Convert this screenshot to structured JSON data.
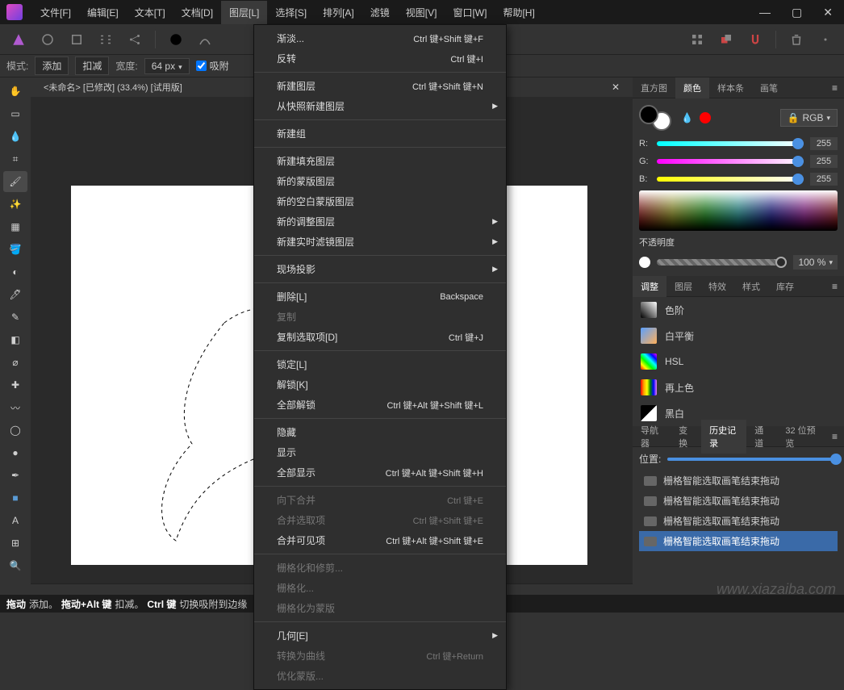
{
  "menubar": [
    "文件[F]",
    "编辑[E]",
    "文本[T]",
    "文档[D]",
    "图层[L]",
    "选择[S]",
    "排列[A]",
    "滤镜",
    "视图[V]",
    "窗口[W]",
    "帮助[H]"
  ],
  "menubar_active_index": 4,
  "options": {
    "mode_label": "模式:",
    "mode_add": "添加",
    "mode_sub": "扣减",
    "width_label": "宽度:",
    "width_value": "64 px",
    "snap_label": "吸附"
  },
  "document": {
    "tab_title": "<未命名> [已修改] (33.4%) [试用版]"
  },
  "dropdown": {
    "items": [
      {
        "label": "渐淡...",
        "shortcut": "Ctrl 键+Shift 键+F"
      },
      {
        "label": "反转",
        "shortcut": "Ctrl 键+I"
      },
      {
        "sep": true
      },
      {
        "label": "新建图层",
        "shortcut": "Ctrl 键+Shift 键+N"
      },
      {
        "label": "从快照新建图层",
        "submenu": true
      },
      {
        "sep": true
      },
      {
        "label": "新建组"
      },
      {
        "sep": true
      },
      {
        "label": "新建填充图层"
      },
      {
        "label": "新的蒙版图层"
      },
      {
        "label": "新的空白蒙版图层"
      },
      {
        "label": "新的调整图层",
        "submenu": true
      },
      {
        "label": "新建实时滤镜图层",
        "submenu": true
      },
      {
        "sep": true
      },
      {
        "label": "现场投影",
        "submenu": true
      },
      {
        "sep": true
      },
      {
        "label": "删除[L]",
        "shortcut": "Backspace"
      },
      {
        "label": "复制",
        "disabled": true
      },
      {
        "label": "复制选取项[D]",
        "shortcut": "Ctrl 键+J"
      },
      {
        "sep": true
      },
      {
        "label": "锁定[L]"
      },
      {
        "label": "解锁[K]"
      },
      {
        "label": "全部解锁",
        "shortcut": "Ctrl 键+Alt 键+Shift 键+L"
      },
      {
        "sep": true
      },
      {
        "label": "隐藏"
      },
      {
        "label": "显示"
      },
      {
        "label": "全部显示",
        "shortcut": "Ctrl 键+Alt 键+Shift 键+H"
      },
      {
        "sep": true
      },
      {
        "label": "向下合并",
        "shortcut": "Ctrl 键+E",
        "disabled": true
      },
      {
        "label": "合并选取项",
        "shortcut": "Ctrl 键+Shift 键+E",
        "disabled": true
      },
      {
        "label": "合并可见项",
        "shortcut": "Ctrl 键+Alt 键+Shift 键+E"
      },
      {
        "sep": true
      },
      {
        "label": "栅格化和修剪...",
        "disabled": true
      },
      {
        "label": "栅格化...",
        "disabled": true
      },
      {
        "label": "栅格化为蒙版",
        "disabled": true
      },
      {
        "sep": true
      },
      {
        "label": "几何[E]",
        "submenu": true
      },
      {
        "label": "转换为曲线",
        "shortcut": "Ctrl 键+Return",
        "disabled": true
      },
      {
        "label": "优化蒙版...",
        "disabled": true
      }
    ]
  },
  "right": {
    "tabs1": [
      "直方图",
      "颜色",
      "样本条",
      "画笔"
    ],
    "tabs1_active": 1,
    "color_mode": "RGB",
    "channels": {
      "R": {
        "value": "255",
        "gradient": "linear-gradient(to right, #00ffff, #ffffff)"
      },
      "G": {
        "value": "255",
        "gradient": "linear-gradient(to right, #ff00ff, #ffffff)"
      },
      "B": {
        "value": "255",
        "gradient": "linear-gradient(to right, #ffff00, #ffffff)"
      }
    },
    "opacity_label": "不透明度",
    "opacity_value": "100 %",
    "tabs2": [
      "调整",
      "图层",
      "特效",
      "样式",
      "库存"
    ],
    "tabs2_active": 0,
    "adjustments": [
      {
        "label": "色阶",
        "swatch": "linear-gradient(to top right,#000,#fff)"
      },
      {
        "label": "白平衡",
        "swatch": "linear-gradient(135deg,#5aa0ff,#ffb05a)"
      },
      {
        "label": "HSL",
        "swatch": "linear-gradient(45deg,red,yellow,lime,cyan,blue,magenta)"
      },
      {
        "label": "再上色",
        "swatch": "linear-gradient(to right,red,orange,yellow,green,blue,violet)"
      },
      {
        "label": "黑白",
        "swatch": "linear-gradient(135deg,#000 50%,#fff 50%)"
      }
    ],
    "tabs3": [
      "导航器",
      "变换",
      "历史记录",
      "通道",
      "32 位预览"
    ],
    "tabs3_active": 2,
    "history": {
      "position_label": "位置:",
      "items": [
        "栅格智能选取画笔结束拖动",
        "栅格智能选取画笔结束拖动",
        "栅格智能选取画笔结束拖动",
        "栅格智能选取画笔结束拖动"
      ],
      "selected_index": 3
    }
  },
  "statusbar": {
    "segments": [
      "拖动",
      " 添加。",
      "拖动+Alt 键",
      " 扣减。",
      "Ctrl 键",
      " 切换吸附到边缘"
    ]
  },
  "watermark": "www.xiazaiba.com"
}
